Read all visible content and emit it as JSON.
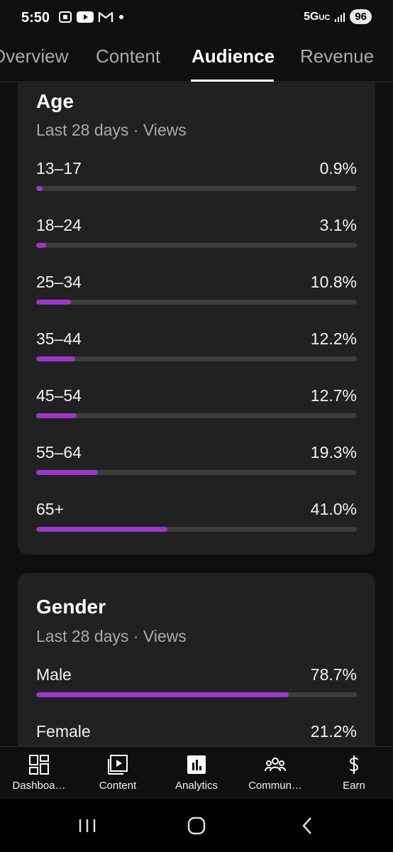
{
  "status_bar": {
    "time": "5:50",
    "network": "5G",
    "network_suffix": "UC",
    "battery": "96"
  },
  "tabs": [
    {
      "label": "Overview"
    },
    {
      "label": "Content"
    },
    {
      "label": "Audience",
      "active": true
    },
    {
      "label": "Revenue"
    }
  ],
  "age_card": {
    "title": "Age",
    "subtitle": "Last 28 days · Views",
    "rows": [
      {
        "label": "13–17",
        "value": "0.9%",
        "percent": 0.9
      },
      {
        "label": "18–24",
        "value": "3.1%",
        "percent": 3.1
      },
      {
        "label": "25–34",
        "value": "10.8%",
        "percent": 10.8
      },
      {
        "label": "35–44",
        "value": "12.2%",
        "percent": 12.2
      },
      {
        "label": "45–54",
        "value": "12.7%",
        "percent": 12.7
      },
      {
        "label": "55–64",
        "value": "19.3%",
        "percent": 19.3
      },
      {
        "label": "65+",
        "value": "41.0%",
        "percent": 41.0
      }
    ]
  },
  "gender_card": {
    "title": "Gender",
    "subtitle": "Last 28 days · Views",
    "rows": [
      {
        "label": "Male",
        "value": "78.7%",
        "percent": 78.7
      },
      {
        "label": "Female",
        "value": "21.2%",
        "percent": 21.2
      }
    ]
  },
  "bottom_nav": [
    {
      "label": "Dashboa…",
      "icon": "dashboard-icon"
    },
    {
      "label": "Content",
      "icon": "content-icon"
    },
    {
      "label": "Analytics",
      "icon": "analytics-icon",
      "active": true
    },
    {
      "label": "Commun…",
      "icon": "community-icon"
    },
    {
      "label": "Earn",
      "icon": "earn-icon"
    }
  ],
  "colors": {
    "accent": "#9b38c8",
    "card": "#212121",
    "background": "#0f0f0f"
  }
}
